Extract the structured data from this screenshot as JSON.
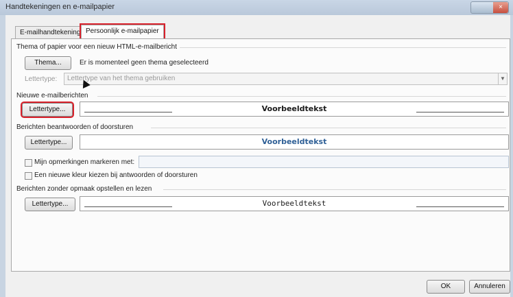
{
  "window": {
    "title": "Handtekeningen en e-mailpapier",
    "close_glyph": "×"
  },
  "tabs": [
    {
      "label": "E-mailhandtekening"
    },
    {
      "label": "Persoonlijk e-mailpapier"
    }
  ],
  "theme_section": {
    "heading": "Thema of papier voor een nieuw HTML-e-mailbericht",
    "theme_button": "Thema...",
    "status": "Er is momenteel geen thema geselecteerd",
    "font_label": "Lettertype:",
    "font_select_value": "Lettertype van het thema gebruiken"
  },
  "new_messages": {
    "heading": "Nieuwe e-mailberichten",
    "font_button": "Lettertype...",
    "sample": "Voorbeeldtekst"
  },
  "replies": {
    "heading": "Berichten beantwoorden of doorsturen",
    "font_button": "Lettertype...",
    "sample": "Voorbeeldtekst",
    "mark_comments_label": "Mijn opmerkingen markeren met:",
    "new_color_label": "Een nieuwe kleur kiezen bij antwoorden of doorsturen"
  },
  "plain_text": {
    "heading": "Berichten zonder opmaak opstellen en lezen",
    "font_button": "Lettertype...",
    "sample": "Voorbeeldtekst"
  },
  "footer": {
    "ok": "OK",
    "cancel": "Annuleren"
  },
  "colors": {
    "highlight": "#d9202a",
    "sample_blue": "#2e5f96"
  }
}
